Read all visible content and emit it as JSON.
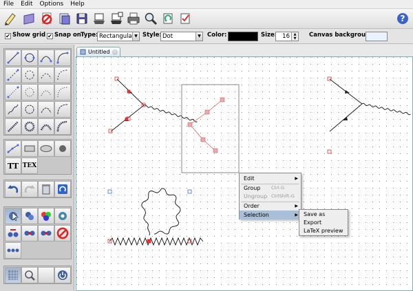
{
  "menubar": {
    "items": [
      "File",
      "Edit",
      "Options",
      "Help"
    ]
  },
  "options": {
    "show_grid_label": "Show grid",
    "show_grid_checked": true,
    "snap_on_label": "Snap on",
    "snap_on_checked": true,
    "type_label": "Type:",
    "type_value": "Rectangular",
    "style_label": "Style:",
    "style_value": "Dot",
    "color_label": "Color:",
    "color_value": "#000000",
    "size_label": "Size:",
    "size_value": "16",
    "canvas_bg_label": "Canvas background:"
  },
  "palette": {
    "text_tool_1": "TT",
    "text_tool_2": "TEX"
  },
  "tab": {
    "title": "Untitled"
  },
  "context_menu": {
    "items": [
      {
        "label": "Edit",
        "submenu": true
      },
      {
        "label": "Group",
        "shortcut": "Ctrl-G"
      },
      {
        "label": "Ungroup",
        "shortcut": "CtrlShift-G",
        "disabled": true
      },
      {
        "label": "Order",
        "submenu": true
      },
      {
        "label": "Selection",
        "submenu": true,
        "highlighted": true
      }
    ]
  },
  "submenu": {
    "items": [
      "Save as",
      "Export",
      "LaTeX preview"
    ]
  }
}
